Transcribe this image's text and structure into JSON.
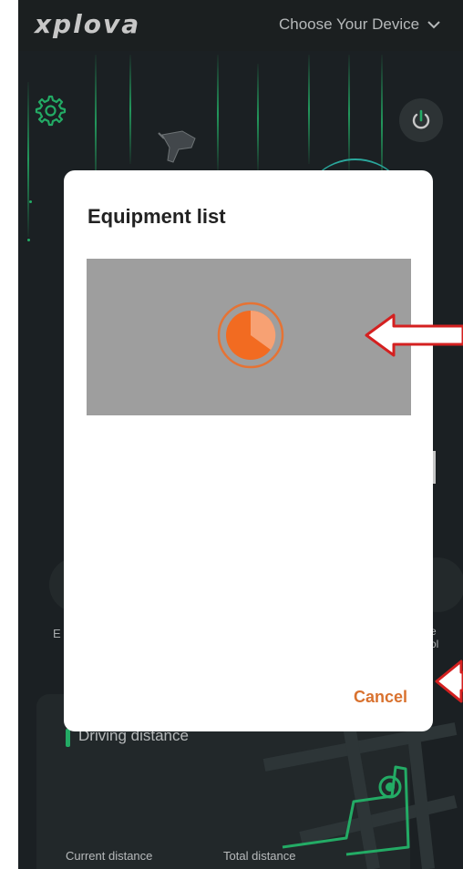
{
  "topbar": {
    "logo": "xplova",
    "device_select_label": "Choose Your Device"
  },
  "background": {
    "side_label_left": "E",
    "side_label_right_1": "e",
    "side_label_right_2": "ol",
    "distance_card": {
      "title": "Driving distance",
      "current_label": "Current distance",
      "total_label": "Total distance"
    }
  },
  "dialog": {
    "title": "Equipment list",
    "cancel_label": "Cancel"
  },
  "colors": {
    "accent_orange": "#d9722f",
    "spinner_orange": "#f26b21",
    "glow_green": "#2edc82",
    "arrow_red": "#d42020"
  },
  "icons": {
    "settings": "gear-icon",
    "power": "power-icon",
    "chevron": "chevron-down-icon",
    "spinner": "loading-spinner-icon"
  }
}
